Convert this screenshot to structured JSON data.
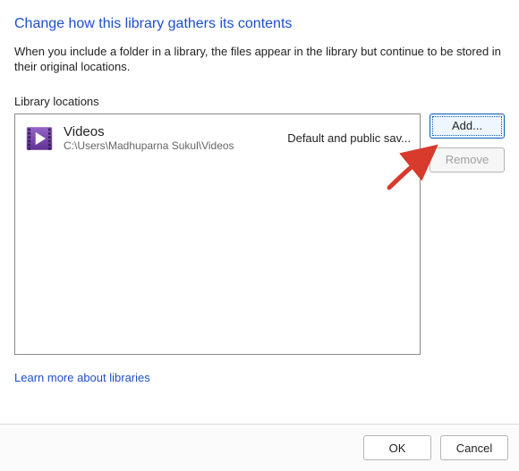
{
  "title": "Change how this library gathers its contents",
  "description": "When you include a folder in a library, the files appear in the library but continue to be stored in their original locations.",
  "section_label": "Library locations",
  "locations": [
    {
      "name": "Videos",
      "path": "C:\\Users\\Madhuparna Sukul\\Videos",
      "badge": "Default and public sav..."
    }
  ],
  "buttons": {
    "add": "Add...",
    "remove": "Remove",
    "ok": "OK",
    "cancel": "Cancel"
  },
  "link": "Learn more about libraries",
  "colors": {
    "accent": "#1c4fc9"
  }
}
